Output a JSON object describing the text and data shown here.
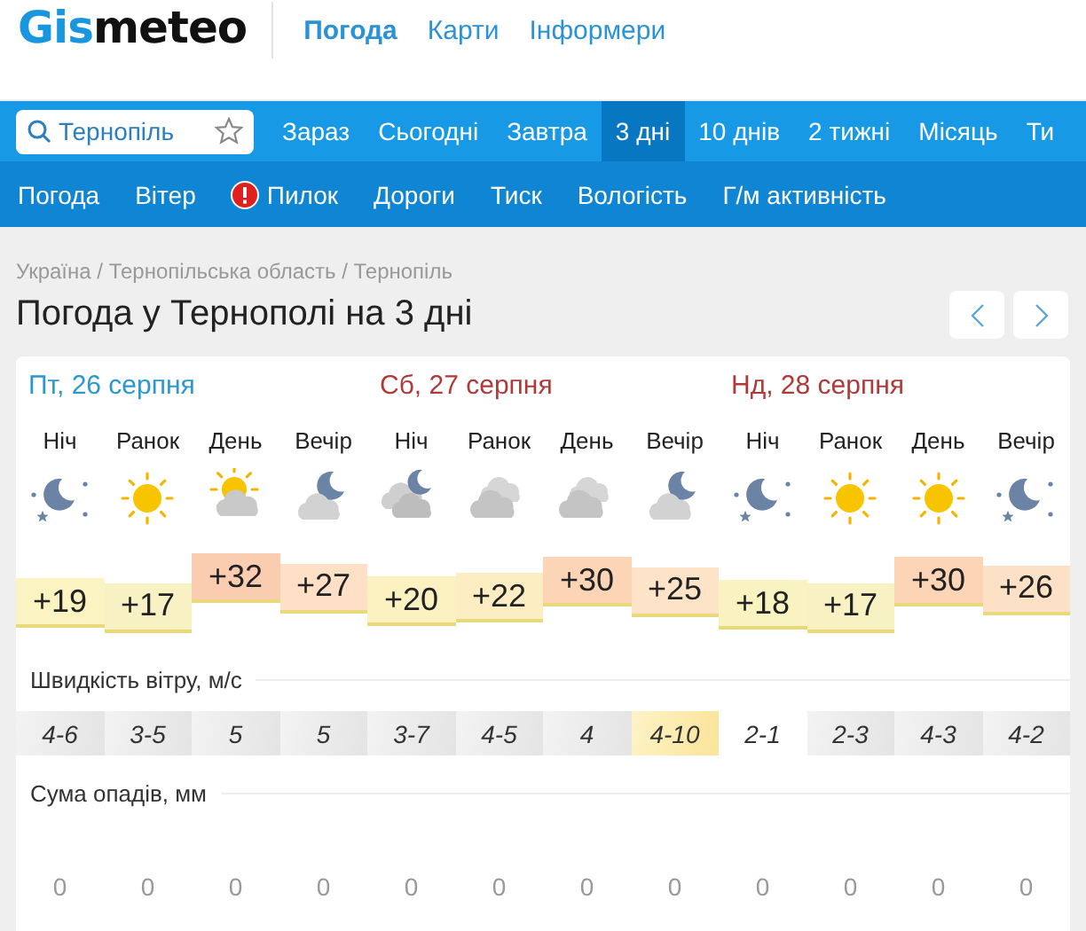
{
  "header": {
    "logo": {
      "accent": "Gis",
      "rest": "meteo"
    },
    "links": [
      {
        "label": "Погода",
        "selected": true
      },
      {
        "label": "Карти",
        "selected": false
      },
      {
        "label": "Інформери",
        "selected": false
      }
    ]
  },
  "search": {
    "value": "Тернопіль"
  },
  "tabs": [
    {
      "label": "Зараз",
      "selected": false
    },
    {
      "label": "Сьогодні",
      "selected": false
    },
    {
      "label": "Завтра",
      "selected": false
    },
    {
      "label": "3 дні",
      "selected": true
    },
    {
      "label": "10 днів",
      "selected": false
    },
    {
      "label": "2 тижні",
      "selected": false
    },
    {
      "label": "Місяць",
      "selected": false
    },
    {
      "label": "Ти",
      "selected": false
    }
  ],
  "subnav": [
    {
      "label": "Погода",
      "alert": false
    },
    {
      "label": "Вітер",
      "alert": false
    },
    {
      "label": "Пилок",
      "alert": true
    },
    {
      "label": "Дороги",
      "alert": false
    },
    {
      "label": "Тиск",
      "alert": false
    },
    {
      "label": "Вологість",
      "alert": false
    },
    {
      "label": "Г/м активність",
      "alert": false
    }
  ],
  "breadcrumb": "Україна / Тернопільська область / Тернопіль",
  "title": "Погода у Тернополі на 3 дні",
  "days": [
    {
      "date": "Пт, 26 серпня",
      "weekend": false
    },
    {
      "date": "Сб, 27 серпня",
      "weekend": true
    },
    {
      "date": "Нд, 28 серпня",
      "weekend": true
    }
  ],
  "periods": [
    {
      "label": "Ніч",
      "kind": "clear-night",
      "temperature": "+19",
      "color": "#fbf3c1",
      "wind": {
        "value": "4-6",
        "kind": "breeze"
      },
      "precipitation": "0"
    },
    {
      "label": "Ранок",
      "kind": "sun",
      "temperature": "+17",
      "color": "#f7f1c3",
      "wind": {
        "value": "3-5",
        "kind": "breeze"
      },
      "precipitation": "0"
    },
    {
      "label": "День",
      "kind": "sun-cloud",
      "temperature": "+32",
      "color": "#fbcdb0",
      "wind": {
        "value": "5",
        "kind": "breeze"
      },
      "precipitation": "0"
    },
    {
      "label": "Вечір",
      "kind": "moon-cloud",
      "temperature": "+27",
      "color": "#fde0c6",
      "wind": {
        "value": "5",
        "kind": "breeze"
      },
      "precipitation": "0"
    },
    {
      "label": "Ніч",
      "kind": "cloud-moon",
      "temperature": "+20",
      "color": "#fcf2c1",
      "wind": {
        "value": "3-7",
        "kind": "breeze"
      },
      "precipitation": "0"
    },
    {
      "label": "Ранок",
      "kind": "cloudy",
      "temperature": "+22",
      "color": "#fdedc3",
      "wind": {
        "value": "4-5",
        "kind": "breeze"
      },
      "precipitation": "0"
    },
    {
      "label": "День",
      "kind": "cloudy",
      "temperature": "+30",
      "color": "#fcd4b6",
      "wind": {
        "value": "4",
        "kind": "breeze"
      },
      "precipitation": "0"
    },
    {
      "label": "Вечір",
      "kind": "moon-cloud",
      "temperature": "+25",
      "color": "#fde3c7",
      "wind": {
        "value": "4-10",
        "kind": "gusty"
      },
      "precipitation": "0"
    },
    {
      "label": "Ніч",
      "kind": "clear-night",
      "temperature": "+18",
      "color": "#f9f2c1",
      "wind": {
        "value": "2-1",
        "kind": "calm"
      },
      "precipitation": "0"
    },
    {
      "label": "Ранок",
      "kind": "sun",
      "temperature": "+17",
      "color": "#f7f1c3",
      "wind": {
        "value": "2-3",
        "kind": "breeze"
      },
      "precipitation": "0"
    },
    {
      "label": "День",
      "kind": "sun",
      "temperature": "+30",
      "color": "#fcd4b6",
      "wind": {
        "value": "4-3",
        "kind": "breeze"
      },
      "precipitation": "0"
    },
    {
      "label": "Вечір",
      "kind": "clear-night",
      "temperature": "+26",
      "color": "#fde1c6",
      "wind": {
        "value": "4-2",
        "kind": "breeze"
      },
      "precipitation": "0"
    }
  ],
  "wind_title": "Швидкість вітру, м/с",
  "precipitation_title": "Сума опадів, мм"
}
